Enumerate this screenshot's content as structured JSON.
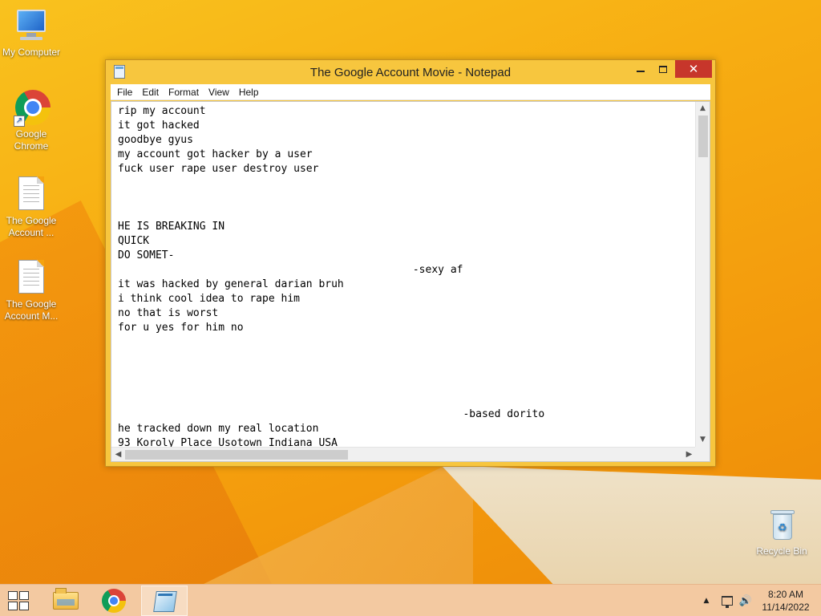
{
  "desktop": {
    "icons": [
      {
        "label": "My Computer",
        "icon": "computer-icon"
      },
      {
        "label_line1": "Google",
        "label_line2": "Chrome",
        "icon": "chrome-icon"
      },
      {
        "label_line1": "The Google",
        "label_line2": "Account ...",
        "icon": "text-file-icon"
      },
      {
        "label_line1": "The Google",
        "label_line2": "Account M...",
        "icon": "text-file-icon"
      },
      {
        "label": "Recycle Bin",
        "icon": "recycle-bin-icon"
      }
    ]
  },
  "window": {
    "title": "The Google Account Movie - Notepad",
    "controls": {
      "minimize": "minimize",
      "maximize": "maximize",
      "close": "✕"
    },
    "menu": [
      "File",
      "Edit",
      "Format",
      "View",
      "Help"
    ],
    "content": "rip my account\nit got hacked\ngoodbye gyus\nmy account got hacker by a user\nfuck user rape user destroy user\n\n\n\nHE IS BREAKING IN\nQUICK\nDO SOMET-\n                                               -sexy af\nit was hacked by general darian bruh\ni think cool idea to rape him\nno that is worst\nfor u yes for him no\n\n\n\n\n\n                                                       -based dorito\nhe tracked down my real location\n93 Koroly Place Usotown Indiana USA"
  },
  "taskbar": {
    "pinned": [
      "file-explorer-icon",
      "chrome-icon",
      "notepad-icon"
    ],
    "active": "notepad-icon",
    "clock": {
      "time": "8:20 AM",
      "date": "11/14/2022"
    }
  },
  "colors": {
    "close_button": "#c7362b",
    "window_frame": "#f7c63e",
    "taskbar": "#f3c9a1"
  }
}
